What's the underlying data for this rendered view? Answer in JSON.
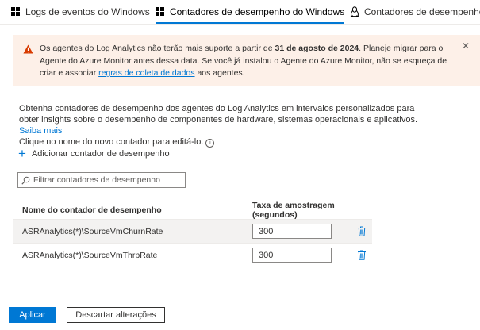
{
  "tabs": [
    {
      "label": "Logs de eventos do Windows",
      "icon": "windows-icon",
      "active": false
    },
    {
      "label": "Contadores de desempenho do Windows",
      "icon": "windows-icon",
      "active": true
    },
    {
      "label": "Contadores de desempenho do Linux",
      "icon": "linux-icon",
      "active": false
    }
  ],
  "banner": {
    "icon": "warning-icon",
    "text_1": "Os agentes do Log Analytics não terão mais suporte a partir de ",
    "date": "31 de agosto de 2024",
    "text_2": ". Planeje migrar para o Agente do Azure Monitor antes dessa data. Se você já instalou o Agente do Azure Monitor, não se esqueça de criar e associar ",
    "link": "regras de coleta de dados",
    "text_3": " aos agentes.",
    "close": "✕",
    "bg_color": "#fdf0e8",
    "icon_color": "#d83b01"
  },
  "description": {
    "text": "Obtenha contadores de desempenho dos agentes do Log Analytics em intervalos personalizados para obter insights sobre o desempenho de componentes de hardware, sistemas operacionais e aplicativos. ",
    "link": "Saiba mais",
    "edit_hint": "Clique no nome do novo contador para editá-lo."
  },
  "add_counter": {
    "icon": "plus-icon",
    "label": "Adicionar contador de desempenho"
  },
  "filter": {
    "icon": "search-icon",
    "placeholder": "Filtrar contadores de desempenho"
  },
  "grid": {
    "headers": {
      "name": "Nome do contador de desempenho",
      "rate": "Taxa de amostragem (segundos)"
    },
    "rows": [
      {
        "name": "ASRAnalytics(*)\\SourceVmChurnRate",
        "rate": "300",
        "selected": true
      },
      {
        "name": "ASRAnalytics(*)\\SourceVmThrpRate",
        "rate": "300",
        "selected": false
      }
    ],
    "delete_icon": "trash-icon"
  },
  "footer": {
    "apply": "Aplicar",
    "discard": "Descartar alterações"
  },
  "colors": {
    "accent": "#0078d4",
    "text": "#323130",
    "border": "#8a8886"
  }
}
